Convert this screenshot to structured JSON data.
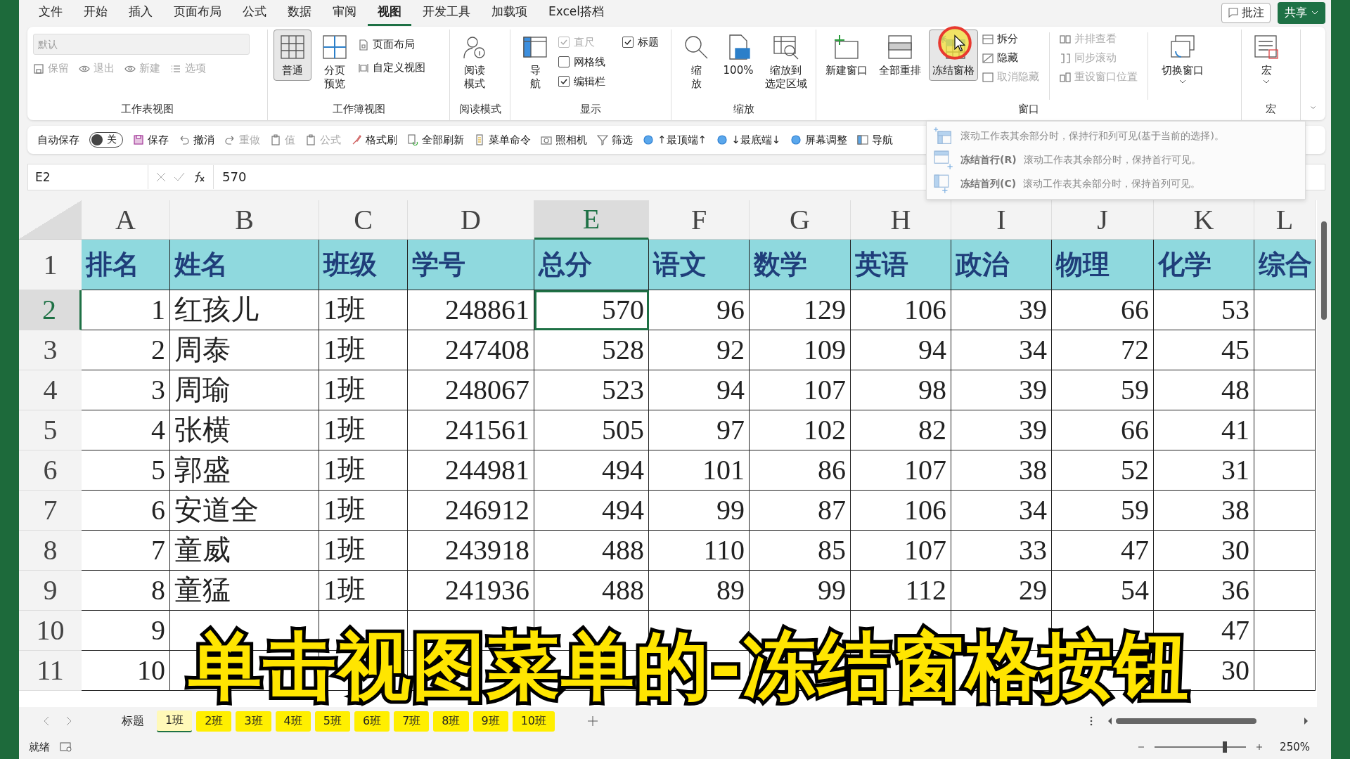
{
  "menu_tabs": [
    {
      "label": "文件",
      "selected": false
    },
    {
      "label": "开始",
      "selected": false
    },
    {
      "label": "插入",
      "selected": false
    },
    {
      "label": "页面布局",
      "selected": false
    },
    {
      "label": "公式",
      "selected": false
    },
    {
      "label": "数据",
      "selected": false
    },
    {
      "label": "审阅",
      "selected": false
    },
    {
      "label": "视图",
      "selected": true
    },
    {
      "label": "开发工具",
      "selected": false
    },
    {
      "label": "加载项",
      "selected": false
    },
    {
      "label": "Excel搭档",
      "selected": false
    }
  ],
  "comment_button": "批注",
  "share_button": "共享",
  "ribbon": {
    "sheet_view": {
      "label": "工作表视图",
      "view_select": {
        "value": "默认",
        "disabled": true
      },
      "buttons": [
        {
          "label": "保留",
          "disabled": true
        },
        {
          "label": "退出",
          "disabled": true
        },
        {
          "label": "新建",
          "disabled": true
        },
        {
          "label": "选项",
          "disabled": true
        }
      ]
    },
    "workbook_view": {
      "label": "工作簿视图",
      "large": [
        {
          "lines": [
            "普通"
          ],
          "selected": true
        },
        {
          "lines": [
            "分页",
            "预览"
          ],
          "selected": false
        }
      ],
      "small": [
        {
          "label": "页面布局",
          "disabled": false
        },
        {
          "label": "自定义视图",
          "disabled": false
        }
      ]
    },
    "reading": {
      "label": "阅读模式",
      "large": [
        {
          "lines": [
            "阅读",
            "模式"
          ],
          "selected": false
        }
      ]
    },
    "show": {
      "label": "显示",
      "large": [
        {
          "lines": [
            "导",
            "航"
          ],
          "selected": false
        }
      ],
      "checks": [
        {
          "label": "直尺",
          "checked": true,
          "disabled": true
        },
        {
          "label": "网格线",
          "checked": false,
          "disabled": false
        },
        {
          "label": "编辑栏",
          "checked": true,
          "disabled": false
        },
        {
          "label": "标题",
          "checked": true,
          "disabled": false
        }
      ]
    },
    "zoom": {
      "label": "缩放",
      "large": [
        {
          "lines": [
            "缩",
            "放"
          ],
          "selected": false
        },
        {
          "lines": [
            "100%"
          ],
          "selected": false
        },
        {
          "lines": [
            "缩放到",
            "选定区域"
          ],
          "selected": false
        }
      ]
    },
    "window": {
      "label": "窗口",
      "large": [
        {
          "lines": [
            "新建窗口"
          ],
          "selected": false
        },
        {
          "lines": [
            "全部重排"
          ],
          "selected": false
        },
        {
          "lines": [
            "冻结窗格"
          ],
          "selected": true
        }
      ],
      "small_1": [
        {
          "label": "拆分",
          "disabled": false
        },
        {
          "label": "隐藏",
          "disabled": false
        },
        {
          "label": "取消隐藏",
          "disabled": true
        }
      ],
      "small_2": [
        {
          "label": "并排查看",
          "disabled": true
        },
        {
          "label": "同步滚动",
          "disabled": true
        },
        {
          "label": "重设窗口位置",
          "disabled": true
        }
      ],
      "switch": {
        "lines": [
          "切换窗口"
        ],
        "selected": false
      }
    },
    "macro": {
      "label": "宏",
      "large": [
        {
          "lines": [
            "宏"
          ],
          "selected": false
        }
      ]
    }
  },
  "quick_bar": {
    "autosave_label": "自动保存",
    "autosave": {
      "on": false,
      "text": "关"
    },
    "buttons": [
      {
        "label": "保存",
        "disabled": false
      },
      {
        "label": "撤消",
        "disabled": false
      },
      {
        "label": "重做",
        "disabled": true
      },
      {
        "label": "值",
        "disabled": true
      },
      {
        "label": "公式",
        "disabled": true
      },
      {
        "label": "格式刷",
        "disabled": false
      },
      {
        "label": "全部刷新",
        "disabled": false
      },
      {
        "label": "菜单命令",
        "disabled": false
      },
      {
        "label": "照相机",
        "disabled": false
      },
      {
        "label": "筛选",
        "disabled": false
      },
      {
        "label": "↑最顶端↑",
        "disabled": false
      },
      {
        "label": "↓最底端↓",
        "disabled": false
      },
      {
        "label": "屏幕调整",
        "disabled": false
      },
      {
        "label": "导航",
        "disabled": false
      }
    ]
  },
  "formula_bar": {
    "name_box": "E2",
    "formula": "570"
  },
  "freeze_menu": {
    "items": [
      {
        "description": "滚动工作表其余部分时，保持行和列可见(基于当前的选择)。"
      },
      {
        "title": "冻结首行(R)",
        "description": "滚动工作表其余部分时，保持首行可见。"
      },
      {
        "title": "冻结首列(C)",
        "description": "滚动工作表其余部分时，保持首列可见。"
      }
    ]
  },
  "grid": {
    "columns": [
      {
        "label": "A",
        "selected": false
      },
      {
        "label": "B",
        "selected": false
      },
      {
        "label": "C",
        "selected": false
      },
      {
        "label": "D",
        "selected": false
      },
      {
        "label": "E",
        "selected": true
      },
      {
        "label": "F",
        "selected": false
      },
      {
        "label": "G",
        "selected": false
      },
      {
        "label": "H",
        "selected": false
      },
      {
        "label": "I",
        "selected": false
      },
      {
        "label": "J",
        "selected": false
      },
      {
        "label": "K",
        "selected": false
      },
      {
        "label": "L",
        "selected": false
      }
    ],
    "rows": [
      {
        "number": "1",
        "selected": false,
        "header": true,
        "cells": [
          "排名",
          "姓名",
          "班级",
          "学号",
          "总分",
          "语文",
          "数学",
          "英语",
          "政治",
          "物理",
          "化学",
          "综合"
        ]
      },
      {
        "number": "2",
        "selected": true,
        "header": false,
        "cells": [
          "1",
          "红孩儿",
          "1班",
          "248861",
          "570",
          "96",
          "129",
          "106",
          "39",
          "66",
          "53",
          null
        ]
      },
      {
        "number": "3",
        "selected": false,
        "header": false,
        "cells": [
          "2",
          "周泰",
          "1班",
          "247408",
          "528",
          "92",
          "109",
          "94",
          "34",
          "72",
          "45",
          null
        ]
      },
      {
        "number": "4",
        "selected": false,
        "header": false,
        "cells": [
          "3",
          "周瑜",
          "1班",
          "248067",
          "523",
          "94",
          "107",
          "98",
          "39",
          "59",
          "48",
          null
        ]
      },
      {
        "number": "5",
        "selected": false,
        "header": false,
        "cells": [
          "4",
          "张横",
          "1班",
          "241561",
          "505",
          "97",
          "102",
          "82",
          "39",
          "66",
          "41",
          null
        ]
      },
      {
        "number": "6",
        "selected": false,
        "header": false,
        "cells": [
          "5",
          "郭盛",
          "1班",
          "244981",
          "494",
          "101",
          "86",
          "107",
          "38",
          "52",
          "31",
          null
        ]
      },
      {
        "number": "7",
        "selected": false,
        "header": false,
        "cells": [
          "6",
          "安道全",
          "1班",
          "246912",
          "494",
          "99",
          "87",
          "106",
          "34",
          "59",
          "38",
          null
        ]
      },
      {
        "number": "8",
        "selected": false,
        "header": false,
        "cells": [
          "7",
          "童威",
          "1班",
          "243918",
          "488",
          "110",
          "85",
          "107",
          "33",
          "47",
          "30",
          null
        ]
      },
      {
        "number": "9",
        "selected": false,
        "header": false,
        "cells": [
          "8",
          "童猛",
          "1班",
          "241936",
          "488",
          "89",
          "99",
          "112",
          "29",
          "54",
          "36",
          null
        ]
      },
      {
        "number": "10",
        "selected": false,
        "header": false,
        "cells": [
          "9",
          null,
          null,
          null,
          null,
          null,
          null,
          null,
          null,
          null,
          "47",
          null
        ]
      },
      {
        "number": "11",
        "selected": false,
        "header": false,
        "cells": [
          "10",
          null,
          null,
          null,
          null,
          null,
          null,
          null,
          null,
          null,
          "30",
          null
        ]
      }
    ]
  },
  "sheet_tabs": [
    {
      "label": "标题",
      "selected": false,
      "highlighted": false
    },
    {
      "label": "1班",
      "selected": true,
      "highlighted": true
    },
    {
      "label": "2班",
      "selected": false,
      "highlighted": true
    },
    {
      "label": "3班",
      "selected": false,
      "highlighted": true
    },
    {
      "label": "4班",
      "selected": false,
      "highlighted": true
    },
    {
      "label": "5班",
      "selected": false,
      "highlighted": true
    },
    {
      "label": "6班",
      "selected": false,
      "highlighted": true
    },
    {
      "label": "7班",
      "selected": false,
      "highlighted": true
    },
    {
      "label": "8班",
      "selected": false,
      "highlighted": true
    },
    {
      "label": "9班",
      "selected": false,
      "highlighted": true
    },
    {
      "label": "10班",
      "selected": false,
      "highlighted": true
    }
  ],
  "status_bar": {
    "status": "就绪",
    "zoom": {
      "level": 0.77,
      "reading": "250%"
    }
  },
  "caption": "单击视图菜单的-冻结窗格按钮"
}
